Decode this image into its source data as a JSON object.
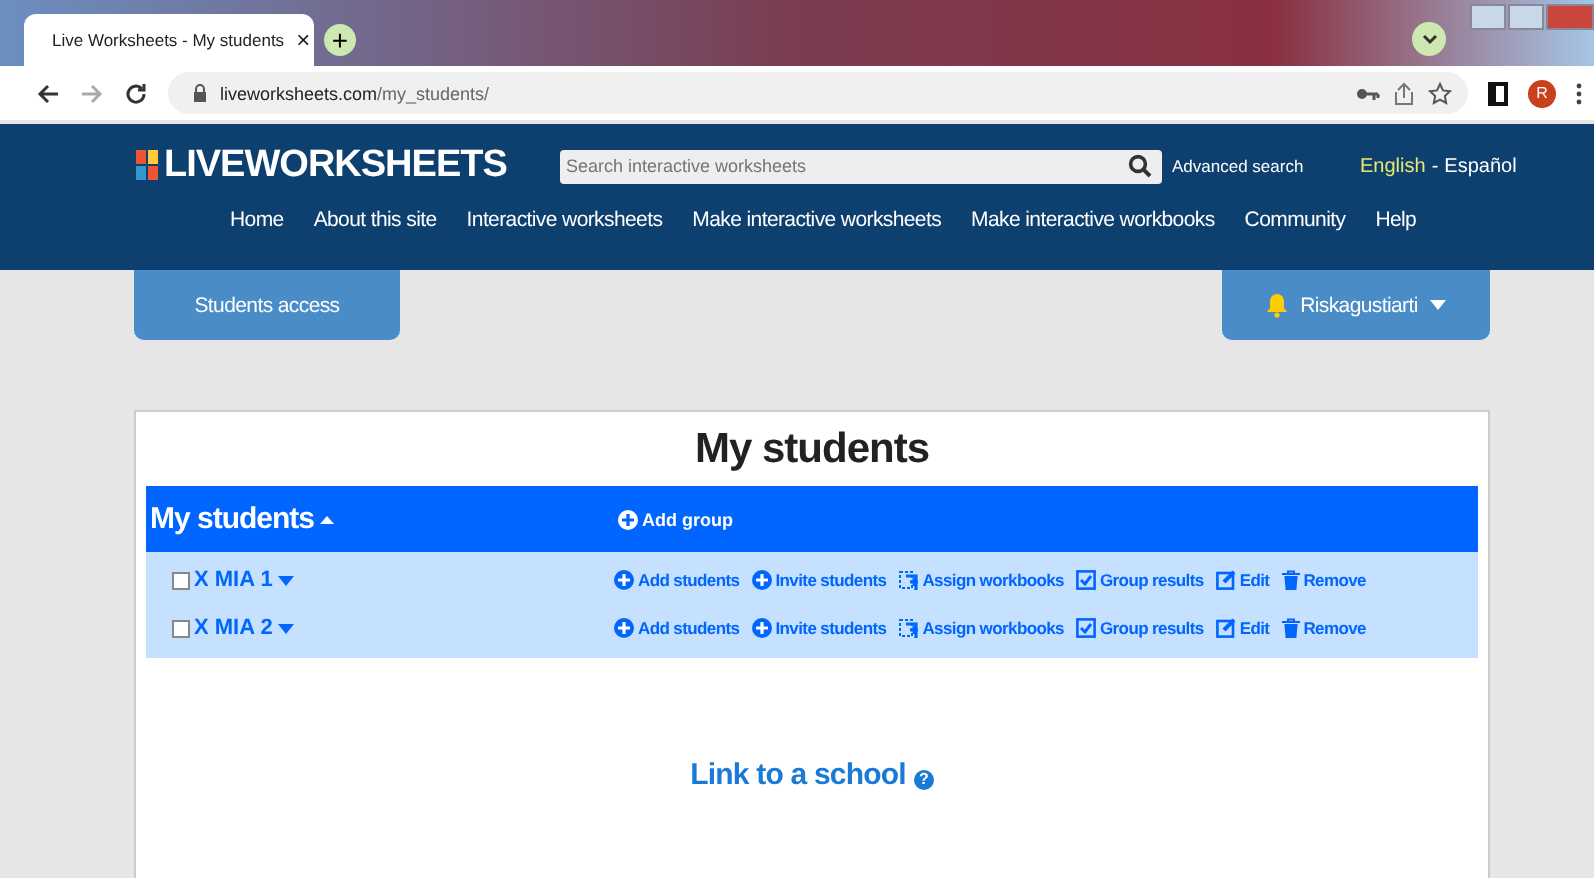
{
  "browser": {
    "tab_title": "Live Worksheets - My students",
    "close": "×",
    "new_tab": "+",
    "url_host": "liveworksheets.com",
    "url_path": "/my_students/",
    "avatar": "R"
  },
  "header": {
    "logo": "LIVEWORKSHEETS",
    "search": {
      "placeholder": "Search interactive worksheets"
    },
    "advanced": "Advanced search",
    "languages": [
      {
        "label": "English",
        "selected": true
      },
      {
        "label": "Español",
        "selected": false
      }
    ],
    "separator": "-"
  },
  "nav": [
    "Home",
    "About this site",
    "Interactive worksheets",
    "Make interactive worksheets",
    "Make interactive workbooks",
    "Community",
    "Help"
  ],
  "students_access": "Students access",
  "user": "Riskagustiarti",
  "title": "My students",
  "groups_header": {
    "label": "My students",
    "add": "Add group"
  },
  "groups": [
    {
      "name": "X MIA 1",
      "checked": false,
      "actions": [
        {
          "kind": "add",
          "label": "Add students"
        },
        {
          "kind": "invite",
          "label": "Invite students"
        },
        {
          "kind": "assign",
          "label": "Assign workbooks"
        },
        {
          "kind": "results",
          "label": "Group results"
        },
        {
          "kind": "edit",
          "label": "Edit"
        },
        {
          "kind": "remove",
          "label": "Remove"
        }
      ]
    },
    {
      "name": "X MIA 2",
      "checked": false,
      "actions": [
        {
          "kind": "add",
          "label": "Add students"
        },
        {
          "kind": "invite",
          "label": "Invite students"
        },
        {
          "kind": "assign",
          "label": "Assign workbooks"
        },
        {
          "kind": "results",
          "label": "Group results"
        },
        {
          "kind": "edit",
          "label": "Edit"
        },
        {
          "kind": "remove",
          "label": "Remove"
        }
      ]
    }
  ],
  "school_link": "Link to a school",
  "help_mark": "?"
}
